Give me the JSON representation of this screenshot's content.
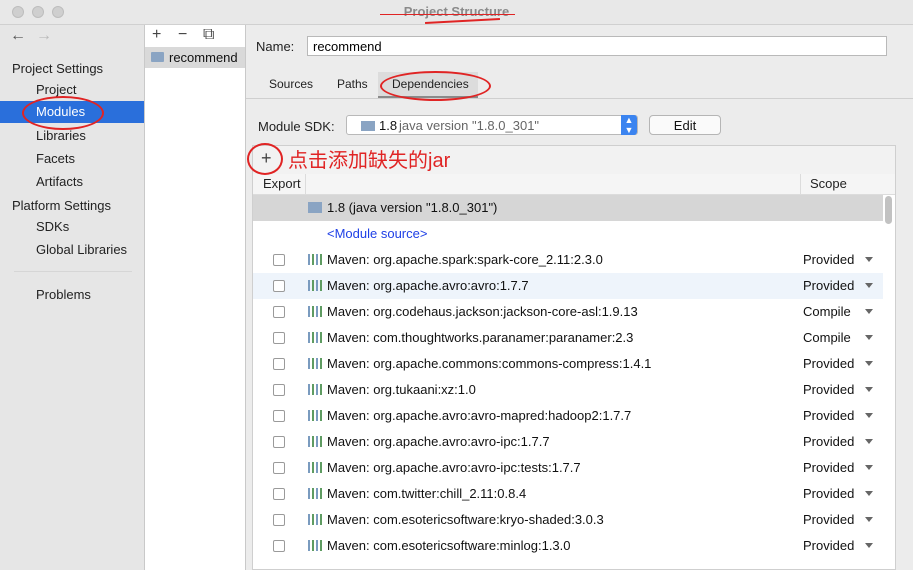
{
  "window": {
    "title": "Project Structure"
  },
  "nav": {
    "back_icon": "←",
    "forward_icon": "→"
  },
  "sidebar": {
    "project_settings": "Project Settings",
    "ps_items": [
      "Project",
      "Modules",
      "Libraries",
      "Facets",
      "Artifacts"
    ],
    "platform_settings": "Platform Settings",
    "pl_items": [
      "SDKs",
      "Global Libraries"
    ],
    "problems": "Problems",
    "selected": "Modules"
  },
  "modules_panel": {
    "add_icon": "+",
    "remove_icon": "−",
    "copy_icon": "⧉",
    "items": [
      "recommend"
    ]
  },
  "module": {
    "name_label": "Name:",
    "name_value": "recommend",
    "tabs": [
      "Sources",
      "Paths",
      "Dependencies"
    ],
    "active_tab": "Dependencies",
    "sdk_label": "Module SDK:",
    "sdk_version": "1.8",
    "sdk_detail": "java version \"1.8.0_301\"",
    "edit_label": "Edit"
  },
  "dependencies": {
    "add_icon": "+",
    "annotation": "点击添加缺失的jar",
    "columns": {
      "export": "Export",
      "scope": "Scope"
    },
    "rows": [
      {
        "label": "1.8 (java version \"1.8.0_301\")",
        "type": "sdk",
        "scope": ""
      },
      {
        "label": "<Module source>",
        "type": "source",
        "scope": ""
      },
      {
        "label": "Maven: org.apache.spark:spark-core_2.11:2.3.0",
        "type": "lib",
        "scope": "Provided"
      },
      {
        "label": "Maven: org.apache.avro:avro:1.7.7",
        "type": "lib",
        "scope": "Provided"
      },
      {
        "label": "Maven: org.codehaus.jackson:jackson-core-asl:1.9.13",
        "type": "lib",
        "scope": "Compile"
      },
      {
        "label": "Maven: com.thoughtworks.paranamer:paranamer:2.3",
        "type": "lib",
        "scope": "Compile"
      },
      {
        "label": "Maven: org.apache.commons:commons-compress:1.4.1",
        "type": "lib",
        "scope": "Provided"
      },
      {
        "label": "Maven: org.tukaani:xz:1.0",
        "type": "lib",
        "scope": "Provided"
      },
      {
        "label": "Maven: org.apache.avro:avro-mapred:hadoop2:1.7.7",
        "type": "lib",
        "scope": "Provided"
      },
      {
        "label": "Maven: org.apache.avro:avro-ipc:1.7.7",
        "type": "lib",
        "scope": "Provided"
      },
      {
        "label": "Maven: org.apache.avro:avro-ipc:tests:1.7.7",
        "type": "lib",
        "scope": "Provided"
      },
      {
        "label": "Maven: com.twitter:chill_2.11:0.8.4",
        "type": "lib",
        "scope": "Provided"
      },
      {
        "label": "Maven: com.esotericsoftware:kryo-shaded:3.0.3",
        "type": "lib",
        "scope": "Provided"
      },
      {
        "label": "Maven: com.esotericsoftware:minlog:1.3.0",
        "type": "lib",
        "scope": "Provided"
      }
    ]
  },
  "colors": {
    "selection": "#2a6fdb",
    "annotation": "#e02424",
    "link": "#1e3fe6"
  }
}
